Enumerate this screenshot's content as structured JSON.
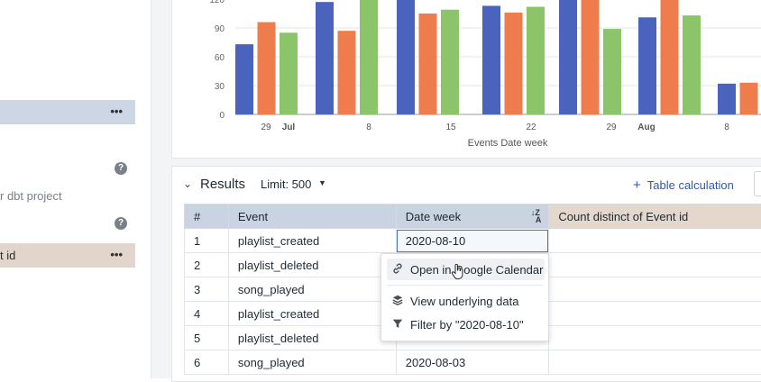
{
  "sidebar": {
    "row1_more": "•••",
    "dbt_text": "r dbt project",
    "row2_label": "t id",
    "row2_more": "•••",
    "help1": "?",
    "help2": "?"
  },
  "chart_data": {
    "type": "bar",
    "xlabel": "Events Date week",
    "ylim": [
      0,
      120
    ],
    "y_ticks": [
      "0",
      "30",
      "60",
      "90",
      "120"
    ],
    "x_tick_labels": [
      "29",
      "Jul",
      "8",
      "15",
      "22",
      "29",
      "Aug",
      "8"
    ],
    "colors": [
      "#4a63bd",
      "#ef7c4d",
      "#8cc46a"
    ],
    "groups": [
      {
        "values": [
          73,
          96,
          85
        ]
      },
      {
        "values": [
          117,
          87,
          128
        ]
      },
      {
        "values": [
          128,
          105,
          109
        ]
      },
      {
        "values": [
          113,
          106,
          112
        ]
      },
      {
        "values": [
          120,
          128,
          89
        ]
      },
      {
        "values": [
          101,
          128,
          103
        ]
      },
      {
        "values": [
          32,
          33,
          null
        ]
      }
    ]
  },
  "results": {
    "title": "Results",
    "limit": "Limit: 500",
    "table_calc": "Table calculation",
    "columns": [
      "#",
      "Event",
      "Date week",
      "Count distinct of Event id"
    ],
    "sort_icon_top": "Z",
    "sort_icon_bottom": "A",
    "rows": [
      {
        "n": "1",
        "event": "playlist_created",
        "date": "2020-08-10",
        "count": ""
      },
      {
        "n": "2",
        "event": "playlist_deleted",
        "date": "",
        "count": ""
      },
      {
        "n": "3",
        "event": "song_played",
        "date": "",
        "count": ""
      },
      {
        "n": "4",
        "event": "playlist_created",
        "date": "",
        "count": ""
      },
      {
        "n": "5",
        "event": "playlist_deleted",
        "date": "",
        "count": ""
      },
      {
        "n": "6",
        "event": "song_played",
        "date": "2020-08-03",
        "count": ""
      }
    ]
  },
  "context_menu": {
    "items": [
      {
        "label": "Open in Google Calendar",
        "icon": "link-icon"
      },
      {
        "label": "View underlying data",
        "icon": "layers-icon"
      },
      {
        "label": "Filter by \"2020-08-10\"",
        "icon": "filter-icon"
      }
    ]
  }
}
